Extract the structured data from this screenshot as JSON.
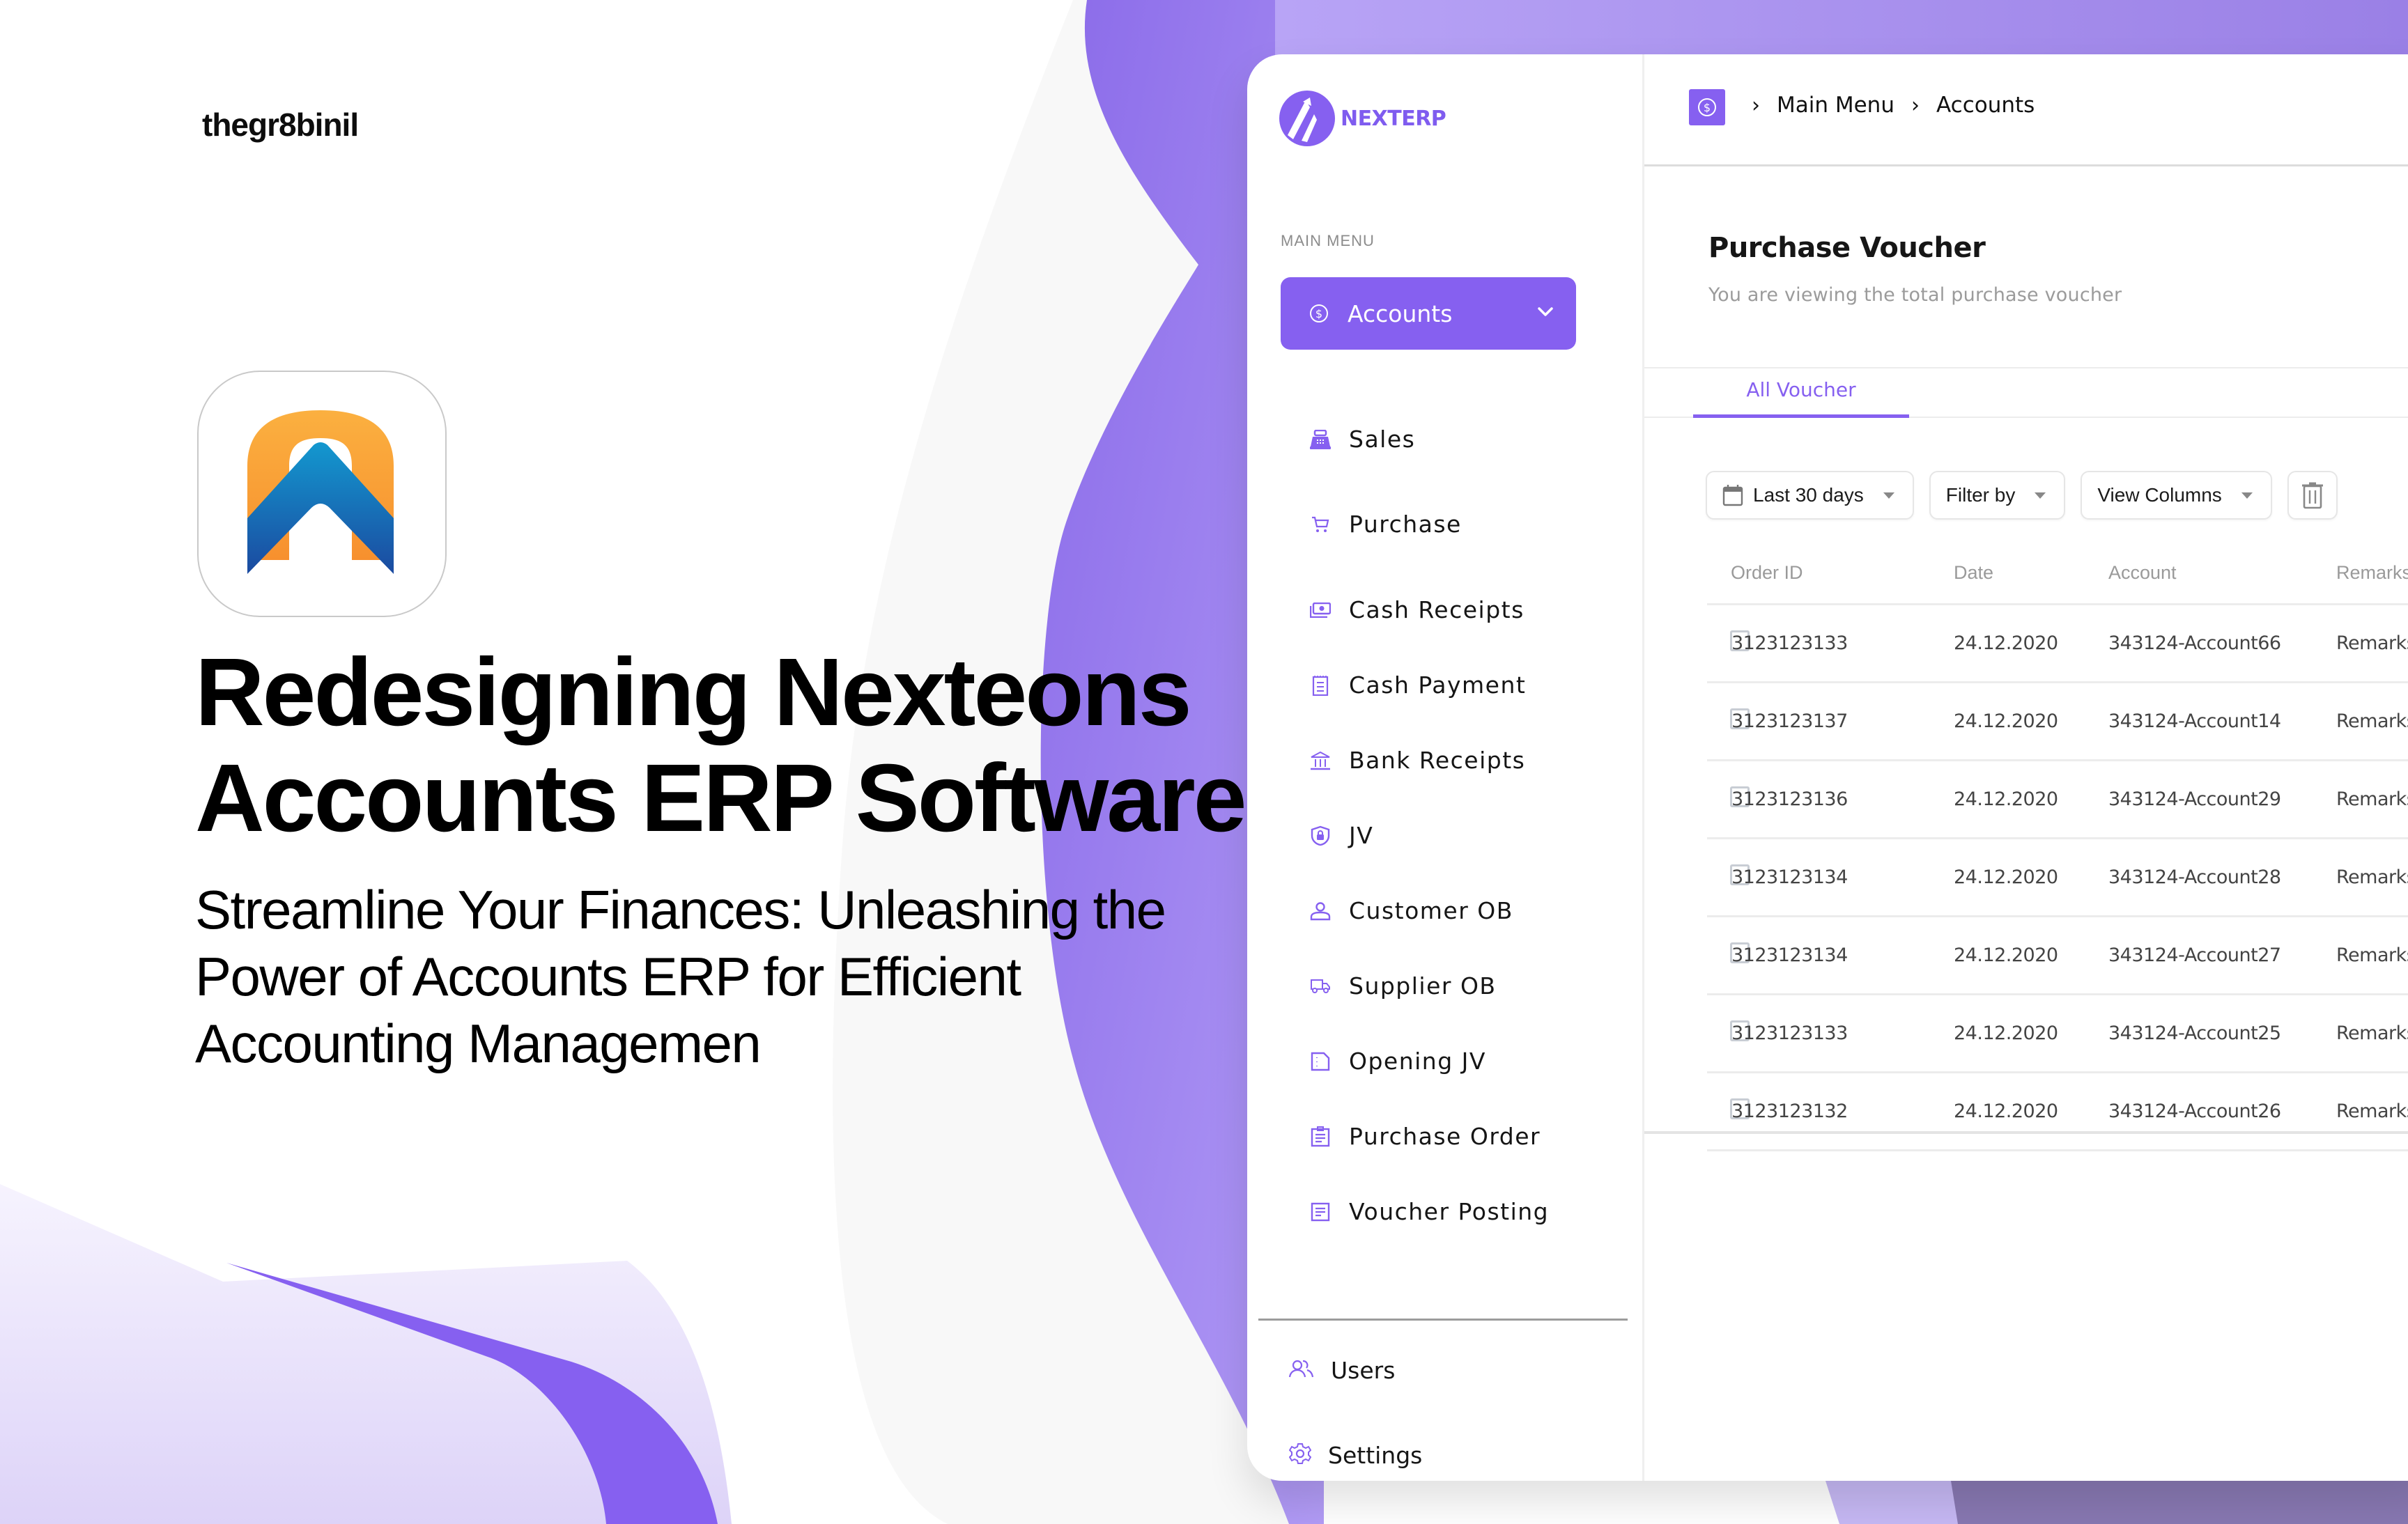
{
  "colors": {
    "accent": "#8660f0",
    "accent_light": "#a78bf7",
    "text_primary": "#111111",
    "text_muted": "#9a9a9a"
  },
  "brand": {
    "author": "thegr8binil"
  },
  "hero": {
    "title_line1": "Redesigning Nexteons",
    "title_line2": "Accounts ERP Software",
    "subtitle_line1": "Streamline Your Finances: Unleashing the",
    "subtitle_line2": "Power of Accounts ERP for Efficient",
    "subtitle_line3": "Accounting Managemen"
  },
  "app": {
    "logo_text": "NEXTERP",
    "sidebar": {
      "section_label": "MAIN MENU",
      "active_item": {
        "label": "Accounts",
        "icon": "dollar-circle-icon"
      },
      "items": [
        {
          "label": "Sales",
          "icon": "cash-register-icon"
        },
        {
          "label": "Purchase",
          "icon": "cart-icon"
        },
        {
          "label": "Cash Receipts",
          "icon": "money-icon"
        },
        {
          "label": "Cash Payment",
          "icon": "notepad-icon"
        },
        {
          "label": "Bank Receipts",
          "icon": "bank-icon"
        },
        {
          "label": "JV",
          "icon": "shield-lock-icon"
        },
        {
          "label": "Customer OB",
          "icon": "user-icon"
        },
        {
          "label": "Supplier OB",
          "icon": "truck-icon"
        },
        {
          "label": "Opening JV",
          "icon": "document-icon"
        },
        {
          "label": "Purchase Order",
          "icon": "clipboard-icon"
        },
        {
          "label": "Voucher Posting",
          "icon": "list-document-icon"
        }
      ],
      "footer_items": [
        {
          "label": "Users",
          "icon": "users-icon"
        },
        {
          "label": "Settings",
          "icon": "gear-icon"
        }
      ]
    },
    "breadcrumb": [
      "Main Menu",
      "Accounts"
    ],
    "page": {
      "title": "Purchase Voucher",
      "subtitle": "You are viewing the total purchase voucher"
    },
    "tabs": [
      {
        "label": "All Voucher",
        "active": true
      }
    ],
    "toolbar": {
      "date_range": "Last 30 days",
      "filter": "Filter by",
      "view_columns": "View Columns"
    },
    "table": {
      "columns": [
        "Order ID",
        "Date",
        "Account",
        "Remarks"
      ],
      "rows": [
        {
          "order_id": "3123123133",
          "date": "24.12.2020",
          "account": "343124-Account66",
          "remarks": "Remarks"
        },
        {
          "order_id": "3123123137",
          "date": "24.12.2020",
          "account": "343124-Account14",
          "remarks": "Remarks"
        },
        {
          "order_id": "3123123136",
          "date": "24.12.2020",
          "account": "343124-Account29",
          "remarks": "Remarks"
        },
        {
          "order_id": "3123123134",
          "date": "24.12.2020",
          "account": "343124-Account28",
          "remarks": "Remarks"
        },
        {
          "order_id": "3123123134",
          "date": "24.12.2020",
          "account": "343124-Account27",
          "remarks": "Remarks"
        },
        {
          "order_id": "3123123133",
          "date": "24.12.2020",
          "account": "343124-Account25",
          "remarks": "Remarks"
        },
        {
          "order_id": "3123123132",
          "date": "24.12.2020",
          "account": "343124-Account26",
          "remarks": "Remarks"
        }
      ]
    }
  }
}
